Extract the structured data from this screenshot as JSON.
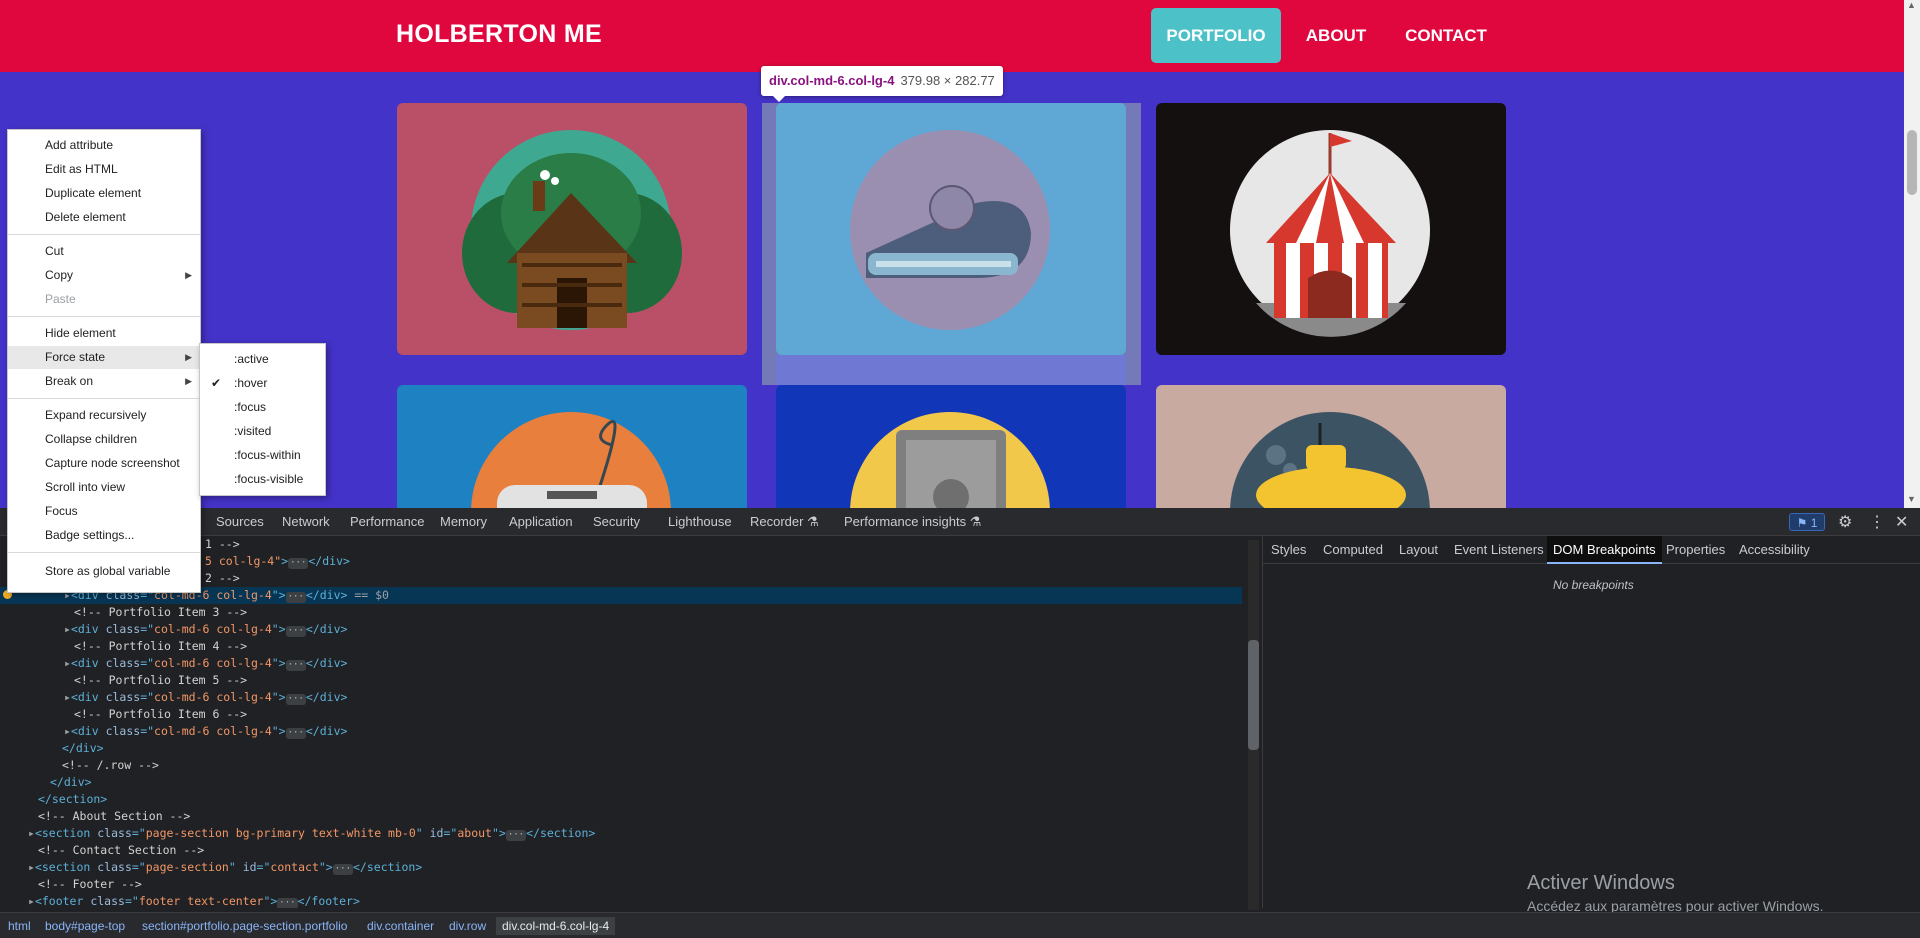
{
  "page": {
    "brand": "HOLBERTON ME",
    "nav": {
      "portfolio": "PORTFOLIO",
      "about": "ABOUT",
      "contact": "CONTACT"
    },
    "colors": {
      "navbar": "#e0073e",
      "section_bg": "#4433c8",
      "nav_active": "#4cc2c8"
    },
    "portfolio_items": [
      {
        "name": "cabin",
        "bg": "#b95068"
      },
      {
        "name": "cake",
        "bg": "#5fa7d4"
      },
      {
        "name": "circus",
        "bg": "#14100f"
      },
      {
        "name": "game",
        "bg": "#1e81c2"
      },
      {
        "name": "safe",
        "bg": "#1136b8"
      },
      {
        "name": "submarine",
        "bg": "#c9aaa0"
      }
    ]
  },
  "tooltip": {
    "tag": "div.col-md-6.col-lg-4",
    "dims": "379.98 × 282.77"
  },
  "context_menu": {
    "items": [
      {
        "label": "Add attribute"
      },
      {
        "label": "Edit as HTML"
      },
      {
        "label": "Duplicate element"
      },
      {
        "label": "Delete element"
      },
      {
        "label": "Cut"
      },
      {
        "label": "Copy"
      },
      {
        "label": "Paste"
      },
      {
        "label": "Hide element"
      },
      {
        "label": "Force state"
      },
      {
        "label": "Break on"
      },
      {
        "label": "Expand recursively"
      },
      {
        "label": "Collapse children"
      },
      {
        "label": "Capture node screenshot"
      },
      {
        "label": "Scroll into view"
      },
      {
        "label": "Focus"
      },
      {
        "label": "Badge settings..."
      },
      {
        "label": "Store as global variable"
      }
    ],
    "submenu": [
      ":active",
      ":hover",
      ":focus",
      ":visited",
      ":focus-within",
      ":focus-visible"
    ],
    "checked": ":hover"
  },
  "devtools": {
    "tabs": [
      "Sources",
      "Network",
      "Performance",
      "Memory",
      "Application",
      "Security",
      "Lighthouse",
      "Recorder",
      "Performance insights"
    ],
    "issues_count": "1",
    "dom": {
      "l0_text": "1 -->",
      "l1_attr_tail": "5 col-lg-4\"",
      "l2_text": "2 -->",
      "div_attr": "col-md-6 col-lg-4",
      "selected_suffix": " == $0",
      "comment3": "<!-- Portfolio Item 3 -->",
      "comment4": "<!-- Portfolio Item 4 -->",
      "comment5": "<!-- Portfolio Item 5 -->",
      "comment6": "<!-- Portfolio Item 6 -->",
      "end_div": "</div>",
      "row_comment": "<!-- /.row -->",
      "end_section": "</section>",
      "about_comment": "<!-- About Section -->",
      "about_class": "page-section bg-primary text-white mb-0",
      "about_id": "about",
      "contact_comment": "<!-- Contact Section -->",
      "contact_class": "page-section",
      "contact_id": "contact",
      "footer_comment": "<!-- Footer -->",
      "footer_class": "footer text-center"
    },
    "side_tabs": [
      "Styles",
      "Computed",
      "Layout",
      "Event Listeners",
      "DOM Breakpoints",
      "Properties",
      "Accessibility"
    ],
    "no_breakpoints": "No breakpoints",
    "activate_title": "Activer Windows",
    "activate_sub": "Accédez aux paramètres pour activer Windows.",
    "breadcrumbs": [
      "html",
      "body#page-top",
      "section#portfolio.page-section.portfolio",
      "div.container",
      "div.row",
      "div.col-md-6.col-lg-4"
    ]
  }
}
